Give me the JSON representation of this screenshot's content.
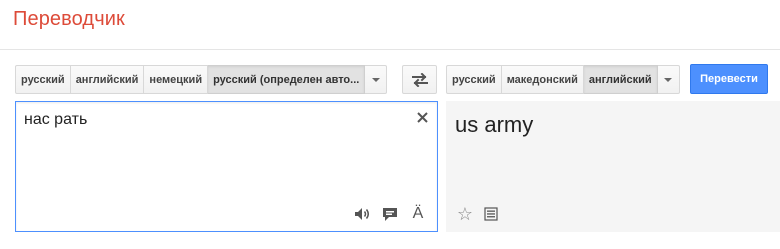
{
  "app": {
    "title": "Переводчик"
  },
  "source_languages": {
    "items": [
      "русский",
      "английский",
      "немецкий",
      "русский (определен авто..."
    ],
    "selected_index": 3
  },
  "target_languages": {
    "items": [
      "русский",
      "македонский",
      "английский"
    ],
    "selected_index": 2
  },
  "translate_button": {
    "label": "Перевести"
  },
  "source": {
    "text": "нас рать"
  },
  "result": {
    "text": "us army"
  },
  "icons": {
    "swap": "swap-arrows-icon",
    "clear": "close-icon",
    "listen": "speaker-icon",
    "feedback": "speech-bubble-icon",
    "input_tools": "a-umlaut-icon",
    "star": "star-icon",
    "dictionary": "list-icon"
  },
  "colors": {
    "title": "#dd4b39",
    "translate_button": "#4d90fe",
    "focus_border": "#4d90fe",
    "result_bg": "#f5f5f5"
  }
}
